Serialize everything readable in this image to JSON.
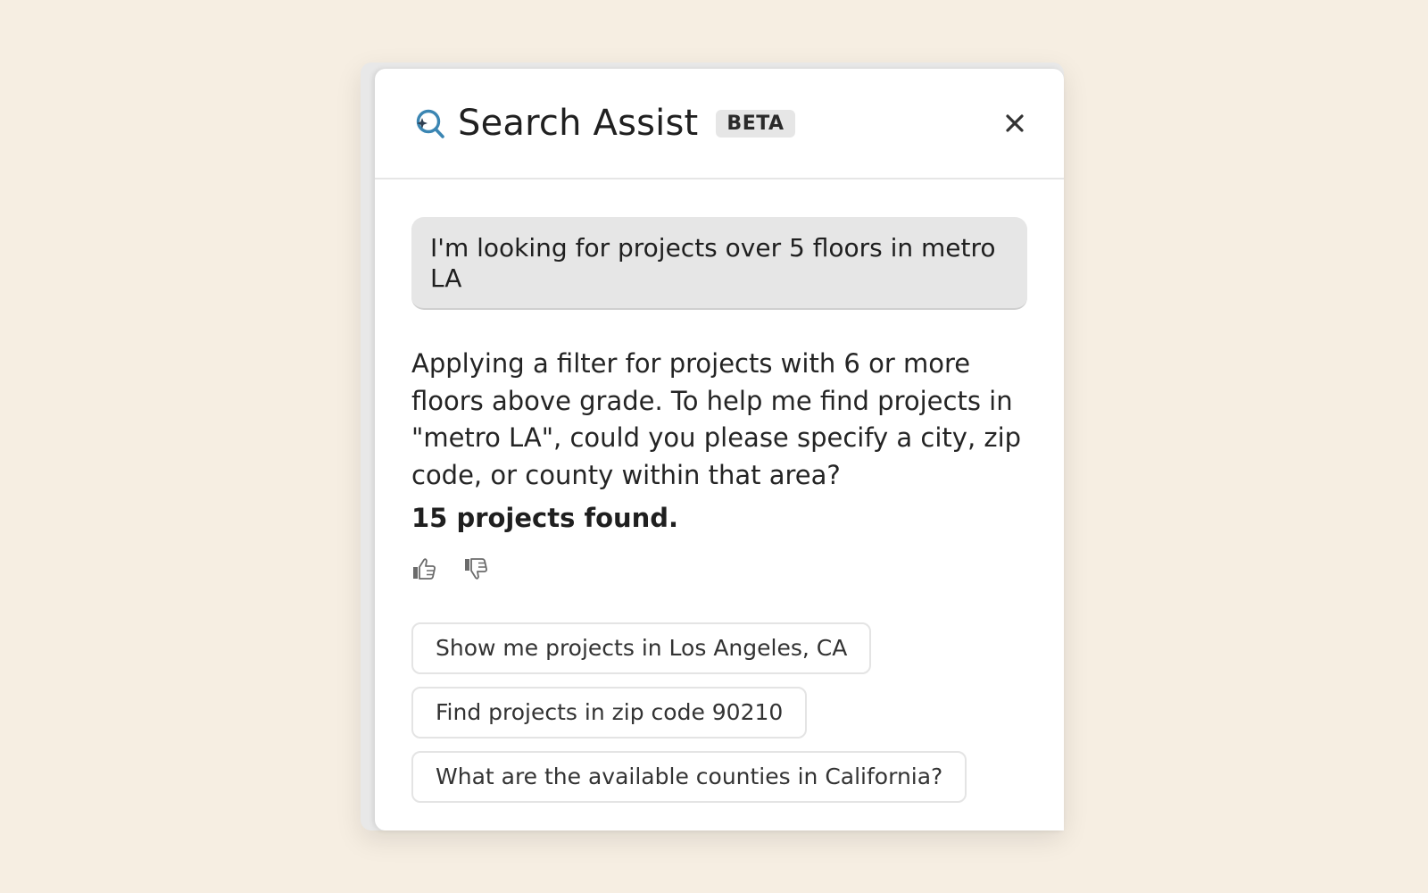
{
  "header": {
    "title": "Search Assist",
    "badge": "BETA",
    "logo_icon": "search-sparkle-icon",
    "close_icon": "close-icon"
  },
  "conversation": {
    "user_message": "I'm looking for projects over 5 floors in metro LA",
    "assistant_message": "Applying a filter for projects with 6 or more floors above grade. To help me find projects in \"metro LA\", could you please specify a city, zip code, or county within that area?",
    "result_count": "15 projects found."
  },
  "feedback": {
    "thumbs_up_icon": "thumbs-up-icon",
    "thumbs_down_icon": "thumbs-down-icon"
  },
  "suggestions": [
    "Show me projects in Los Angeles, CA",
    "Find projects in zip code 90210",
    "What are the available counties in California?"
  ],
  "colors": {
    "background": "#f6eee2",
    "accent": "#3b86b3",
    "bubble": "#e6e6e6"
  }
}
